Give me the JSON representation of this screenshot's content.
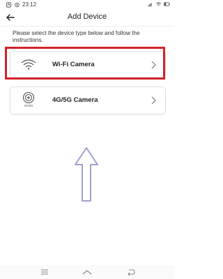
{
  "status": {
    "time": "23:12"
  },
  "header": {
    "title": "Add Device"
  },
  "instructions": "Please select the device type below and follow the instructions.",
  "devices": [
    {
      "label": "Wi-Fi Camera",
      "icon": "wifi-icon",
      "highlighted": true
    },
    {
      "label": "4G/5G Camera",
      "icon": "cellular-camera-icon",
      "icon_text": "4G/5G",
      "highlighted": false
    }
  ],
  "annotation": {
    "arrow_direction": "up",
    "highlight_color": "#d2232a",
    "arrow_color": "#9ea0cf"
  },
  "navbar": {
    "buttons": [
      "menu",
      "home",
      "back"
    ]
  }
}
